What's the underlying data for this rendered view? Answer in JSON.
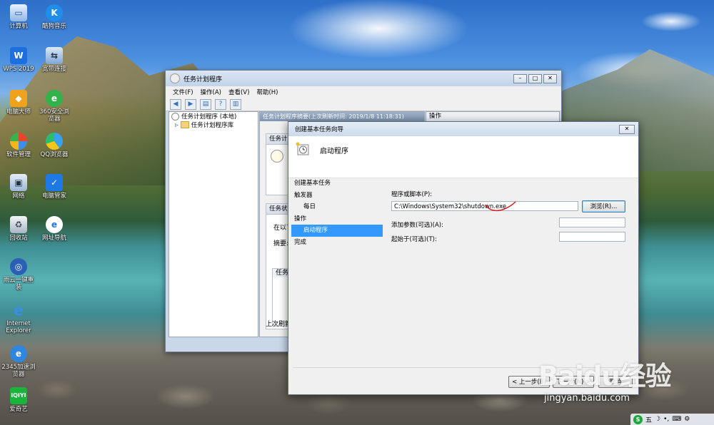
{
  "desktop": {
    "icons": [
      {
        "label": "计算机",
        "icon": "computer-icon"
      },
      {
        "label": "酷狗音乐",
        "icon": "kugou-music-icon"
      },
      {
        "label": "WPS 2019",
        "icon": "wps-icon"
      },
      {
        "label": "宽带连接",
        "icon": "broadband-icon"
      },
      {
        "label": "电脑大师",
        "icon": "pc-master-icon"
      },
      {
        "label": "360安全浏览器",
        "icon": "360-browser-icon"
      },
      {
        "label": "软件管理",
        "icon": "software-manager-icon"
      },
      {
        "label": "QQ浏览器",
        "icon": "qq-browser-icon"
      },
      {
        "label": "网络",
        "icon": "network-icon"
      },
      {
        "label": "电脑管家",
        "icon": "pc-manager-icon"
      },
      {
        "label": "回收站",
        "icon": "recycle-bin-icon"
      },
      {
        "label": "网址导航",
        "icon": "ie-nav-icon"
      },
      {
        "label": "雨云一键重装",
        "icon": "reinstall-icon"
      },
      {
        "label": "Internet Explorer",
        "icon": "ie-icon"
      },
      {
        "label": "2345加速浏览器",
        "icon": "2345-browser-icon"
      },
      {
        "label": "爱奇艺",
        "icon": "iqiyi-icon"
      }
    ]
  },
  "main_window": {
    "title": "任务计划程序",
    "menu": [
      "文件(F)",
      "操作(A)",
      "查看(V)",
      "帮助(H)"
    ],
    "tree": {
      "root": "任务计划程序 (本地)",
      "child": "任务计划程序库"
    },
    "summary_header": "任务计划程序摘要(上次刷新时间: 2019/1/8 11:18:31)",
    "section1_title": "任务计",
    "section2_title": "任务状",
    "section2_text": "在以下",
    "summary_label": "摘要:",
    "task_label": "任务",
    "last_refresh": "上次刷新",
    "actions_header": "操作"
  },
  "wizard": {
    "title": "创建基本任务向导",
    "header": "启动程序",
    "steps": [
      {
        "label": "创建基本任务",
        "level": "head",
        "active": false
      },
      {
        "label": "触发器",
        "level": "head",
        "active": false
      },
      {
        "label": "每日",
        "level": "sub",
        "active": false
      },
      {
        "label": "操作",
        "level": "head",
        "active": false
      },
      {
        "label": "启动程序",
        "level": "sub",
        "active": true
      },
      {
        "label": "完成",
        "level": "head",
        "active": false
      }
    ],
    "program_label": "程序或脚本(P):",
    "program_value": "C:\\Windows\\System32\\shutdown.exe",
    "browse_label": "浏览(R)...",
    "args_label": "添加参数(可选)(A):",
    "args_value": "",
    "start_in_label": "起始于(可选)(T):",
    "start_in_value": "",
    "back_label": "< 上一步(B)",
    "next_label": "下一步(N) >",
    "cancel_label": "取消"
  },
  "tray": {
    "ime": "五",
    "icons": [
      "ime-icon",
      "moon-icon",
      "punctuation-icon",
      "keyboard-icon",
      "settings-icon"
    ]
  },
  "watermark": {
    "brand": "Baidu经验",
    "url": "jingyan.baidu.com"
  },
  "colors": {
    "selection": "#3399ff",
    "annotation": "#d42020"
  }
}
